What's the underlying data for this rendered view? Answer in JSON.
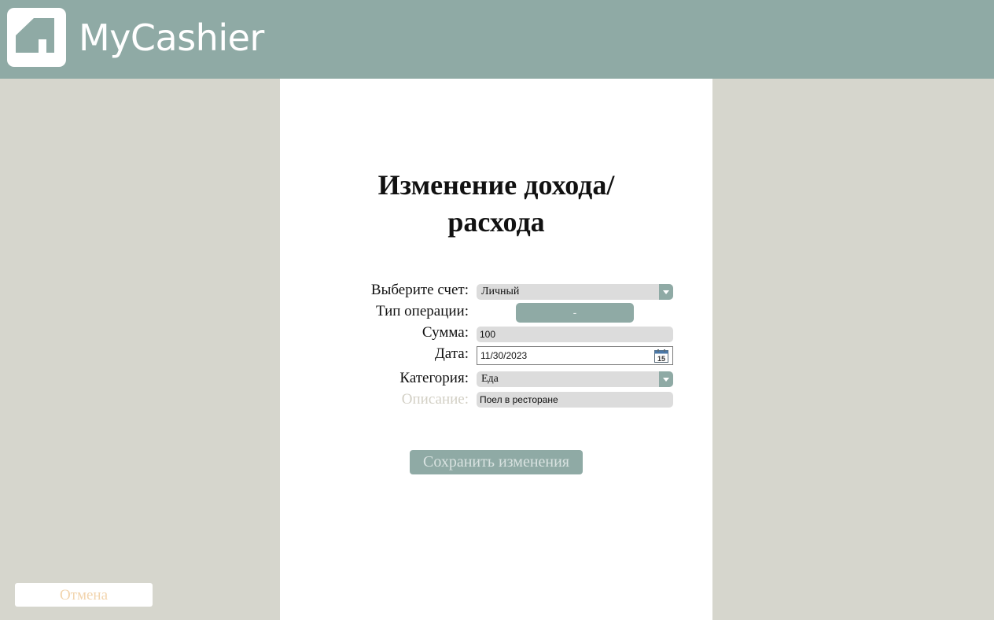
{
  "app": {
    "title": "MyCashier",
    "logo_icon": "house-icon"
  },
  "colors": {
    "accent": "#8faaa5",
    "background": "#d6d6cd",
    "panel": "#ffffff",
    "field": "#dcdcdc",
    "cancel_text": "#f2d4ad"
  },
  "form": {
    "title_line1": "Изменение дохода/",
    "title_line2": "расхода",
    "account": {
      "label": "Выберите счет:",
      "value": "Личный"
    },
    "operation": {
      "label": "Тип операции:",
      "value": "-"
    },
    "amount": {
      "label": "Сумма:",
      "value": "100"
    },
    "date": {
      "label": "Дата:",
      "value": "11/30/2023",
      "icon": "calendar-icon",
      "calendar_day": "15"
    },
    "category": {
      "label": "Категория:",
      "value": "Еда"
    },
    "description": {
      "label": "Описание:",
      "value": "Поел в ресторане"
    },
    "save_label": "Сохранить изменения"
  },
  "footer": {
    "cancel_label": "Отмена"
  }
}
